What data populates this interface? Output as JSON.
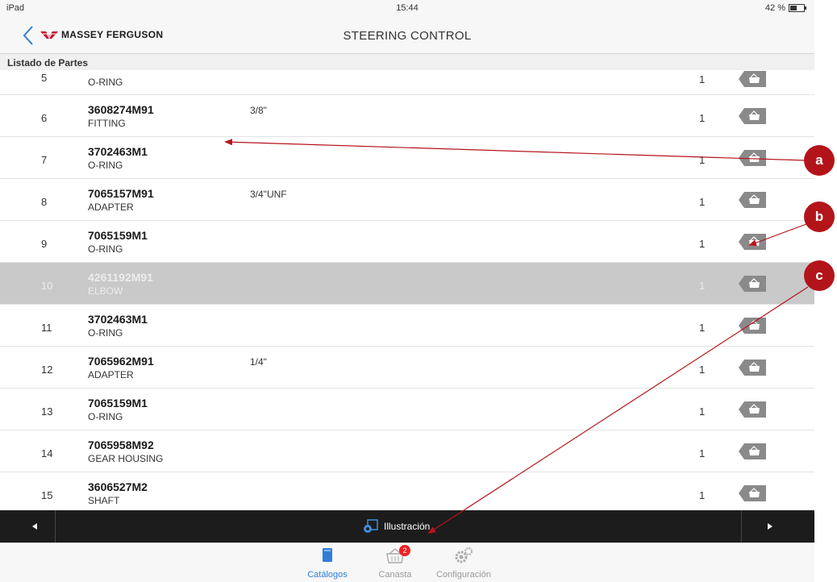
{
  "status_bar": {
    "device": "iPad",
    "time": "15:44",
    "battery": "42 %"
  },
  "nav": {
    "brand": "MASSEY FERGUSON",
    "title": "STEERING CONTROL"
  },
  "section_header": "Listado de Partes",
  "rows": [
    {
      "num": "5",
      "part": "",
      "desc": "O-RING",
      "spec": "",
      "qty": "1"
    },
    {
      "num": "6",
      "part": "3608274M91",
      "desc": "FITTING",
      "spec": "3/8\"",
      "qty": "1"
    },
    {
      "num": "7",
      "part": "3702463M1",
      "desc": "O-RING",
      "spec": "",
      "qty": "1"
    },
    {
      "num": "8",
      "part": "7065157M91",
      "desc": "ADAPTER",
      "spec": "3/4\"UNF",
      "qty": "1"
    },
    {
      "num": "9",
      "part": "7065159M1",
      "desc": "O-RING",
      "spec": "",
      "qty": "1"
    },
    {
      "num": "10",
      "part": "4261192M91",
      "desc": "ELBOW",
      "spec": "",
      "qty": "1"
    },
    {
      "num": "11",
      "part": "3702463M1",
      "desc": "O-RING",
      "spec": "",
      "qty": "1"
    },
    {
      "num": "12",
      "part": "7065962M91",
      "desc": "ADAPTER",
      "spec": "1/4\"",
      "qty": "1"
    },
    {
      "num": "13",
      "part": "7065159M1",
      "desc": "O-RING",
      "spec": "",
      "qty": "1"
    },
    {
      "num": "14",
      "part": "7065958M92",
      "desc": "GEAR HOUSING",
      "spec": "",
      "qty": "1"
    },
    {
      "num": "15",
      "part": "3606527M2",
      "desc": "SHAFT",
      "spec": "",
      "qty": "1"
    }
  ],
  "selected_row": "10",
  "toolbar": {
    "illustration_label": "Illustración"
  },
  "tabs": [
    {
      "label": "Catálogos",
      "active": true
    },
    {
      "label": "Canasta",
      "badge": "2"
    },
    {
      "label": "Configuración"
    }
  ],
  "callouts": [
    "a",
    "b",
    "c"
  ],
  "colors": {
    "accent": "#2f7ed8",
    "callout": "#b3141a",
    "toolbar": "#1c1c1c",
    "selected_row": "#c9c9c9",
    "cart_button": "#8a8a8a"
  }
}
